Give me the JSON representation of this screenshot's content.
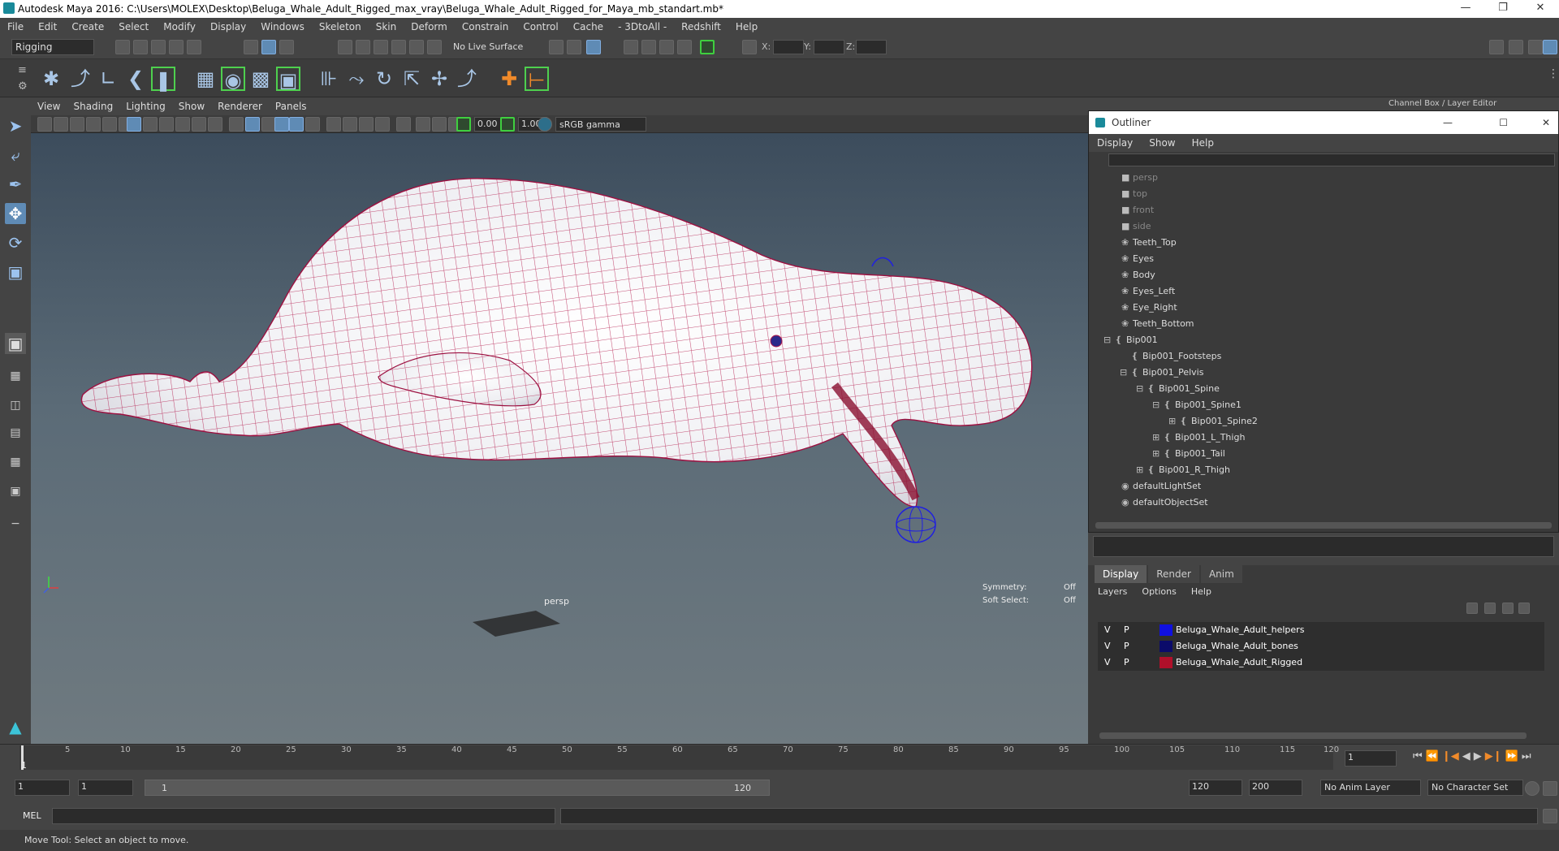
{
  "window": {
    "title": "Autodesk Maya 2016: C:\\Users\\MOLEX\\Desktop\\Beluga_Whale_Adult_Rigged_max_vray\\Beluga_Whale_Adult_Rigged_for_Maya_mb_standart.mb*",
    "controls": [
      "—",
      "❐",
      "✕"
    ]
  },
  "menubar": [
    "File",
    "Edit",
    "Create",
    "Select",
    "Modify",
    "Display",
    "Windows",
    "Skeleton",
    "Skin",
    "Deform",
    "Constrain",
    "Control",
    "Cache",
    "- 3DtoAll -",
    "Redshift",
    "Help"
  ],
  "toolbar": {
    "mode": "Rigging",
    "live_surface": "No Live Surface",
    "x_label": "X:",
    "y_label": "Y:",
    "z_label": "Z:"
  },
  "viewport": {
    "menu": [
      "View",
      "Shading",
      "Lighting",
      "Show",
      "Renderer",
      "Panels"
    ],
    "exposure": "0.00",
    "gamma": "1.00",
    "color_space": "sRGB gamma",
    "camera_label": "persp",
    "symmetry_label": "Symmetry:",
    "symmetry_value": "Off",
    "soft_select_label": "Soft Select:",
    "soft_select_value": "Off"
  },
  "right_panel": {
    "header": "Channel Box / Layer Editor",
    "outliner": {
      "title": "Outliner",
      "menu": [
        "Display",
        "Show",
        "Help"
      ],
      "items": [
        {
          "label": "persp",
          "icon": "camera-icon",
          "dim": true
        },
        {
          "label": "top",
          "icon": "camera-icon",
          "dim": true
        },
        {
          "label": "front",
          "icon": "camera-icon",
          "dim": true
        },
        {
          "label": "side",
          "icon": "camera-icon",
          "dim": true
        },
        {
          "label": "Teeth_Top",
          "icon": "mesh-icon",
          "dim": false
        },
        {
          "label": "Eyes",
          "icon": "mesh-icon",
          "dim": false
        },
        {
          "label": "Body",
          "icon": "mesh-icon",
          "dim": false
        },
        {
          "label": "Eyes_Left",
          "icon": "mesh-icon",
          "dim": false
        },
        {
          "label": "Eye_Right",
          "icon": "mesh-icon",
          "dim": false
        },
        {
          "label": "Teeth_Bottom",
          "icon": "mesh-icon",
          "dim": false
        },
        {
          "label": "Bip001",
          "icon": "joint-icon",
          "dim": false
        },
        {
          "label": "Bip001_Footsteps",
          "icon": "joint-icon",
          "dim": false
        },
        {
          "label": "Bip001_Pelvis",
          "icon": "joint-icon",
          "dim": false
        },
        {
          "label": "Bip001_Spine",
          "icon": "joint-icon",
          "dim": false
        },
        {
          "label": "Bip001_Spine1",
          "icon": "joint-icon",
          "dim": false
        },
        {
          "label": "Bip001_Spine2",
          "icon": "joint-icon",
          "dim": false
        },
        {
          "label": "Bip001_L_Thigh",
          "icon": "joint-icon",
          "dim": false
        },
        {
          "label": "Bip001_Tail",
          "icon": "joint-icon",
          "dim": false
        },
        {
          "label": "Bip001_R_Thigh",
          "icon": "joint-icon",
          "dim": false
        },
        {
          "label": "defaultLightSet",
          "icon": "set-icon",
          "dim": false
        },
        {
          "label": "defaultObjectSet",
          "icon": "set-icon",
          "dim": false
        }
      ]
    },
    "layer_tabs": [
      "Display",
      "Render",
      "Anim"
    ],
    "layer_menu": [
      "Layers",
      "Options",
      "Help"
    ],
    "layers": [
      {
        "v": "V",
        "p": "P",
        "color": "#1010e0",
        "name": "Beluga_Whale_Adult_helpers"
      },
      {
        "v": "V",
        "p": "P",
        "color": "#0b0b6a",
        "name": "Beluga_Whale_Adult_bones"
      },
      {
        "v": "V",
        "p": "P",
        "color": "#b0102a",
        "name": "Beluga_Whale_Adult_Rigged"
      }
    ]
  },
  "timeline": {
    "ticks": [
      "5",
      "10",
      "15",
      "20",
      "25",
      "30",
      "35",
      "40",
      "45",
      "50",
      "55",
      "60",
      "65",
      "70",
      "75",
      "80",
      "85",
      "90",
      "95",
      "100",
      "105",
      "110",
      "115",
      "120"
    ],
    "current_frame_label": "1",
    "current_frame": "1",
    "range_start": "1",
    "playback_start": "1",
    "slider_start": "1",
    "slider_end": "120",
    "playback_end": "120",
    "range_end": "200",
    "anim_layer": "No Anim Layer",
    "character_set": "No Character Set"
  },
  "mel": {
    "label": "MEL"
  },
  "status": {
    "text": "Move Tool: Select an object to move."
  }
}
